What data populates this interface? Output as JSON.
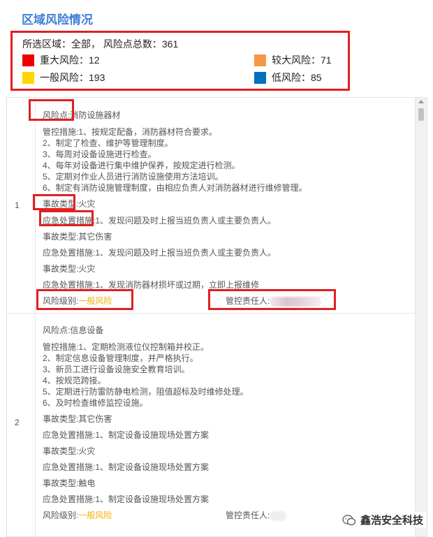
{
  "title": "区域风险情况",
  "summary": {
    "line1": "所选区域：全部，  风险点总数：361",
    "legend": [
      {
        "label": "重大风险：12",
        "color": "#ee0000"
      },
      {
        "label": "较大风险：71",
        "color": "#f79646"
      },
      {
        "label": "一般风险：193",
        "color": "#ffd700"
      },
      {
        "label": "低风险：85",
        "color": "#0070c0"
      }
    ]
  },
  "rows": [
    {
      "index": "1",
      "risk_point": "风险点:消防设施器材",
      "measures": [
        "管控措施:1、按规定配备，消防器材符合要求。",
        "2、制定了检查、维护等管理制度。",
        "3、每周对设备设施进行检查。",
        "4、每年对设备进行集中维护保养，按规定进行检测。",
        "5、定期对作业人员进行消防设施使用方法培训。",
        "6、制定有消防设施管理制度，由相应负责人对消防器材进行维修管理。"
      ],
      "accidents": [
        {
          "type": "事故类型:火灾",
          "emergency": "应急处置措施:1、发现问题及时上报当班负责人或主要负责人。"
        },
        {
          "type": "事故类型:其它伤害",
          "emergency": "应急处置措施:1、发现问题及时上报当班负责人或主要负责人。"
        },
        {
          "type": "事故类型:火灾",
          "emergency": "应急处置措施:1、发现消防器材损坏或过期，立即上报维修"
        }
      ],
      "level_label": "风险级别:",
      "level_value": "一般风险",
      "owner_label": "管控责任人:"
    },
    {
      "index": "2",
      "risk_point": "风险点:信息设备",
      "measures": [
        "管控措施:1、定期检测液位仪控制箱并校正。",
        "2、制定信息设备管理制度，并严格执行。",
        "3、新员工进行设备设施安全教育培训。",
        "4、按规范跨接。",
        "5、定期进行防雷防静电检测，阻值超标及时维修处理。",
        "6、及时检查维修监控设施。"
      ],
      "accidents": [
        {
          "type": "事故类型:其它伤害",
          "emergency": "应急处置措施:1、制定设备设施现场处置方案"
        },
        {
          "type": "事故类型:火灾",
          "emergency": "应急处置措施:1、制定设备设施现场处置方案"
        },
        {
          "type": "事故类型:触电",
          "emergency": "应急处置措施:1、制定设备设施现场处置方案"
        }
      ],
      "level_label": "风险级别:",
      "level_value": "一般风险",
      "owner_label": "管控责任人:"
    }
  ],
  "watermark": "鑫浩安全科技"
}
